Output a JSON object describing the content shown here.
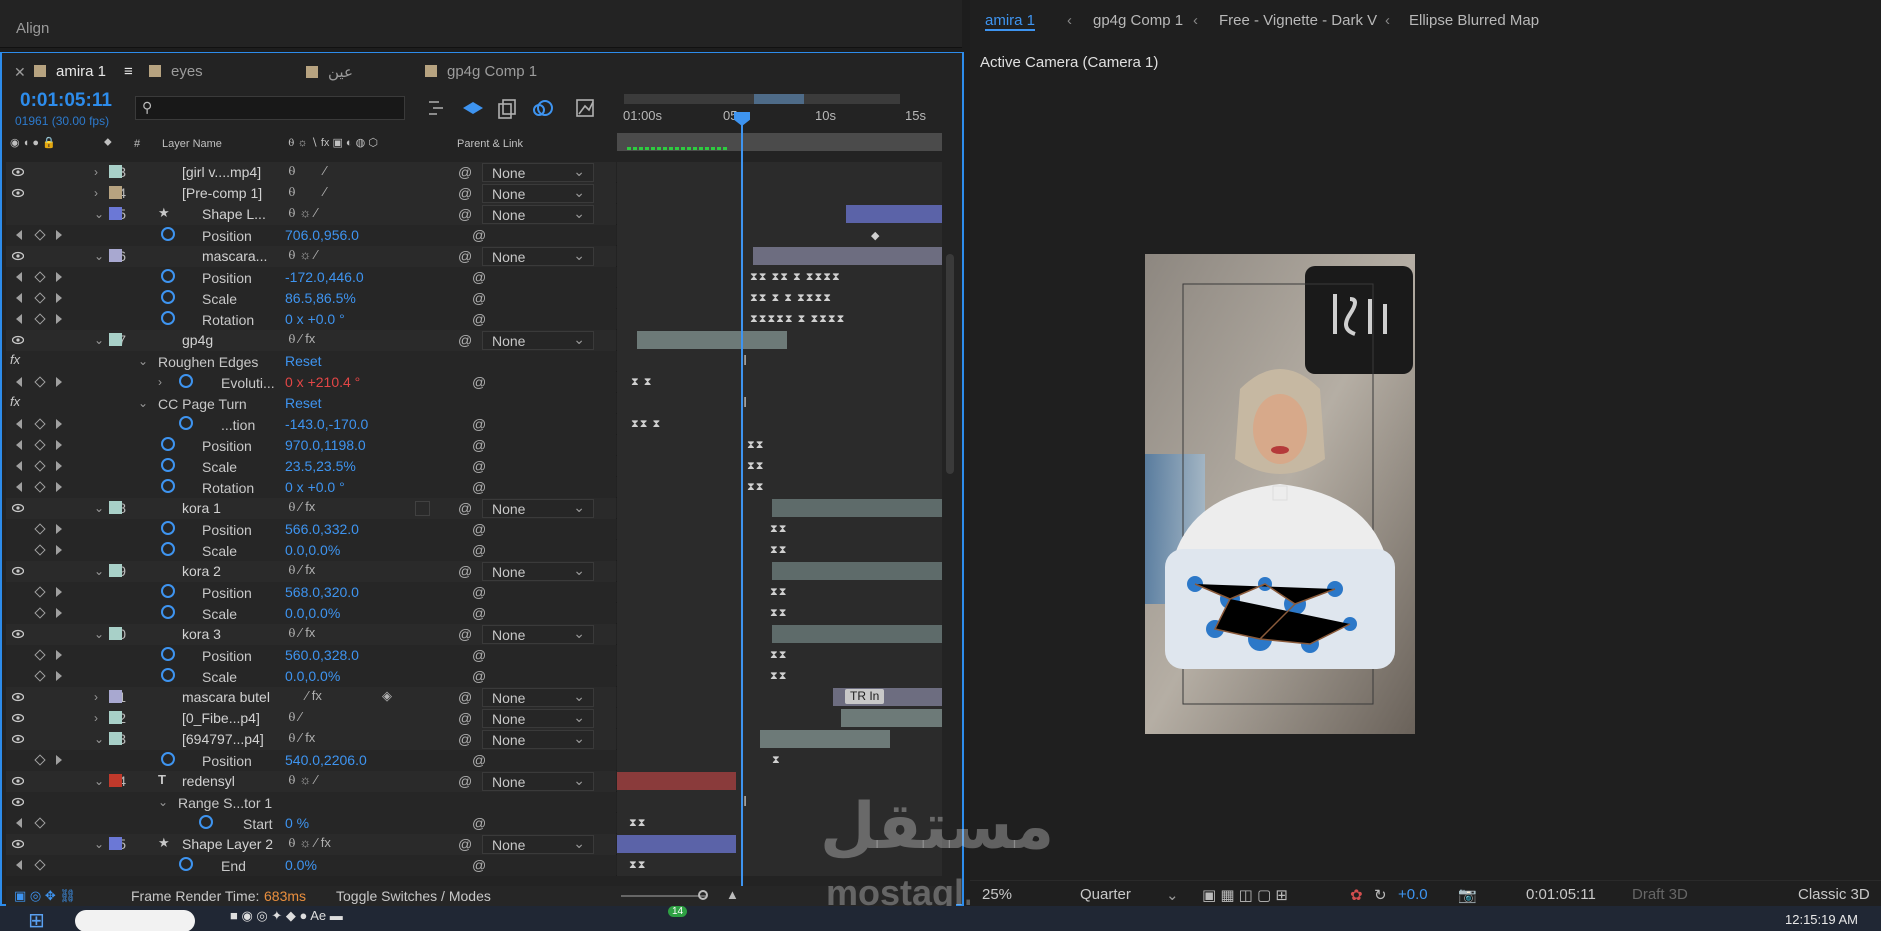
{
  "panel_title": "Align",
  "timeline_tabs": [
    {
      "label": "amira 1"
    },
    {
      "label": "eyes"
    },
    {
      "label": "عين"
    },
    {
      "label": "gp4g Comp 1"
    }
  ],
  "timecode": "0:01:05:11",
  "frame_info": "01961 (30.00 fps)",
  "search_placeholder": "",
  "ruler_ticks": [
    "01:00s",
    "05s",
    "10s",
    "15s"
  ],
  "columns": {
    "number": "#",
    "layer_name": "Layer Name",
    "parent": "Parent & Link"
  },
  "parent_default": "None",
  "rows": {
    "l13": {
      "num": "13",
      "name": "[girl v....mp4]",
      "parent": "None"
    },
    "l14": {
      "num": "14",
      "name": "[Pre-comp 1]",
      "parent": "None"
    },
    "l15": {
      "num": "15",
      "name": "Shape L...",
      "parent": "None"
    },
    "p15pos": {
      "name": "Position",
      "value": "706.0,956.0"
    },
    "l16": {
      "num": "16",
      "name": "mascara...",
      "parent": "None"
    },
    "p16pos": {
      "name": "Position",
      "value": "-172.0,446.0"
    },
    "p16scale": {
      "name": "Scale",
      "value": "86.5,86.5%"
    },
    "p16rot": {
      "name": "Rotation",
      "value": "0 x +0.0 °"
    },
    "l17": {
      "num": "17",
      "name": "gp4g",
      "parent": "None"
    },
    "fx1": {
      "name": "Roughen Edges",
      "reset": "Reset"
    },
    "p17evo": {
      "name": "Evoluti...",
      "value": "0 x +210.4 °"
    },
    "fx2": {
      "name": "CC Page Turn",
      "reset": "Reset"
    },
    "p17tion": {
      "name": "...tion",
      "value": "-143.0,-170.0"
    },
    "p17pos": {
      "name": "Position",
      "value": "970.0,1198.0"
    },
    "p17scale": {
      "name": "Scale",
      "value": "23.5,23.5%"
    },
    "p17rot": {
      "name": "Rotation",
      "value": "0 x +0.0 °"
    },
    "l18": {
      "num": "18",
      "name": "kora 1",
      "parent": "None"
    },
    "p18pos": {
      "name": "Position",
      "value": "566.0,332.0"
    },
    "p18scale": {
      "name": "Scale",
      "value": "0.0,0.0%"
    },
    "l19": {
      "num": "19",
      "name": "kora 2",
      "parent": "None"
    },
    "p19pos": {
      "name": "Position",
      "value": "568.0,320.0"
    },
    "p19scale": {
      "name": "Scale",
      "value": "0.0,0.0%"
    },
    "l20": {
      "num": "20",
      "name": "kora 3",
      "parent": "None"
    },
    "p20pos": {
      "name": "Position",
      "value": "560.0,328.0"
    },
    "p20scale": {
      "name": "Scale",
      "value": "0.0,0.0%"
    },
    "l21": {
      "num": "21",
      "name": "mascara butel",
      "parent": "None",
      "marker": "TR In"
    },
    "l22": {
      "num": "22",
      "name": "[0_Fibe...p4]",
      "parent": "None"
    },
    "l23": {
      "num": "23",
      "name": "[694797...p4]",
      "parent": "None"
    },
    "p23pos": {
      "name": "Position",
      "value": "540.0,2206.0"
    },
    "l24": {
      "num": "24",
      "name": "redensyl",
      "parent": "None"
    },
    "range": {
      "name": "Range S...tor 1"
    },
    "p24start": {
      "name": "Start",
      "value": "0 %"
    },
    "l25": {
      "num": "25",
      "name": "Shape Layer 2",
      "parent": "None"
    },
    "p25end": {
      "name": "End",
      "value": "0.0%"
    }
  },
  "status": {
    "render_label": "Frame Render Time:",
    "render_value": "683ms",
    "toggle": "Toggle Switches / Modes"
  },
  "comp_tabs": [
    "amira 1",
    "gp4g Comp 1",
    "Free - Vignette - Dark V",
    "Ellipse Blurred Map"
  ],
  "active_camera": "Active Camera (Camera 1)",
  "viewer": {
    "zoom": "25%",
    "resolution": "Quarter",
    "exposure": "+0.0",
    "timecode": "0:01:05:11",
    "draft": "Draft 3D",
    "renderer": "Classic 3D"
  },
  "watermark": {
    "arabic": "مستقل",
    "latin": "mostaql.com"
  },
  "taskbar": {
    "badge": "14",
    "clock": "12:15:19 AM"
  },
  "colors": {
    "accent": "#2d8ceb",
    "value_blue": "#3e94f0",
    "render_orange": "#ea8f3e"
  },
  "icons": [
    "eye-icon",
    "lock-icon",
    "stopwatch-icon",
    "graph-icon",
    "pickwhip-icon",
    "keyframe-icon"
  ]
}
